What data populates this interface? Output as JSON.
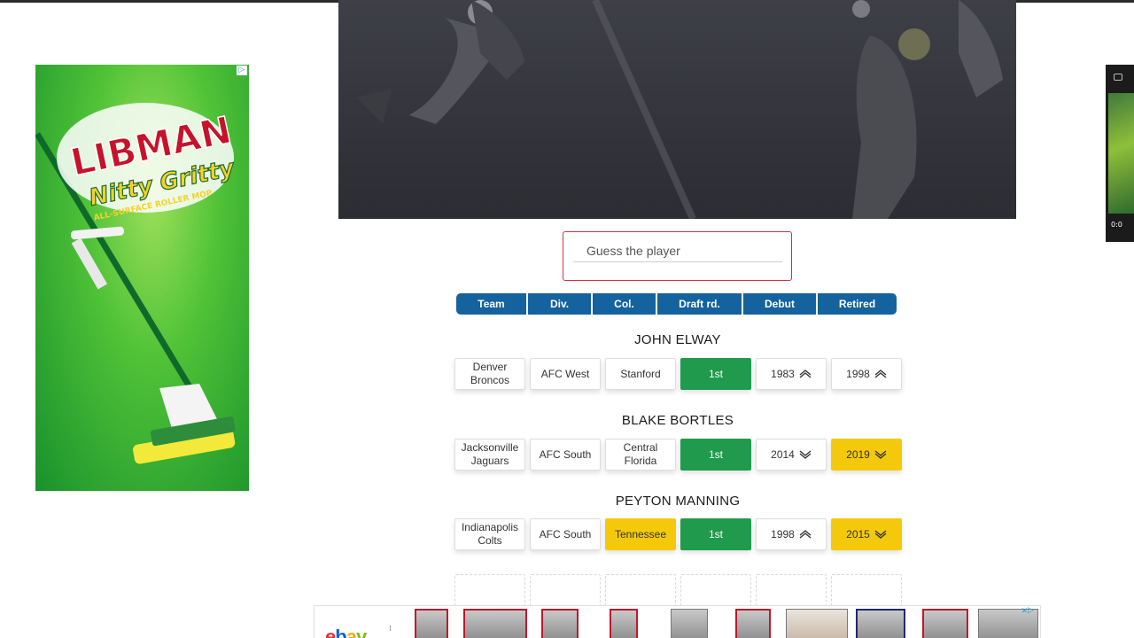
{
  "ad_left": {
    "brand": "LIBMAN",
    "product": "Nitty Gritty",
    "tagline": "ALL-SURFACE ROLLER MOP",
    "choices_icon": "adchoices-icon"
  },
  "ad_right": {
    "time": "0:0"
  },
  "guess": {
    "placeholder": "Guess the player"
  },
  "headers": [
    "Team",
    "Div.",
    "Col.",
    "Draft rd.",
    "Debut",
    "Retired"
  ],
  "guesses": [
    {
      "name": "JOHN ELWAY",
      "cells": [
        {
          "text": "Denver Broncos",
          "status": "none",
          "arrow": ""
        },
        {
          "text": "AFC West",
          "status": "none",
          "arrow": ""
        },
        {
          "text": "Stanford",
          "status": "none",
          "arrow": ""
        },
        {
          "text": "1st",
          "status": "correct",
          "arrow": ""
        },
        {
          "text": "1983",
          "status": "none",
          "arrow": "up"
        },
        {
          "text": "1998",
          "status": "none",
          "arrow": "up"
        }
      ]
    },
    {
      "name": "BLAKE BORTLES",
      "cells": [
        {
          "text": "Jacksonville Jaguars",
          "status": "none",
          "arrow": ""
        },
        {
          "text": "AFC South",
          "status": "none",
          "arrow": ""
        },
        {
          "text": "Central Florida",
          "status": "none",
          "arrow": ""
        },
        {
          "text": "1st",
          "status": "correct",
          "arrow": ""
        },
        {
          "text": "2014",
          "status": "none",
          "arrow": "down"
        },
        {
          "text": "2019",
          "status": "close",
          "arrow": "down"
        }
      ]
    },
    {
      "name": "PEYTON MANNING",
      "cells": [
        {
          "text": "Indianapolis Colts",
          "status": "none",
          "arrow": ""
        },
        {
          "text": "AFC South",
          "status": "none",
          "arrow": ""
        },
        {
          "text": "Tennessee",
          "status": "close",
          "arrow": ""
        },
        {
          "text": "1st",
          "status": "correct",
          "arrow": ""
        },
        {
          "text": "1998",
          "status": "none",
          "arrow": "up"
        },
        {
          "text": "2015",
          "status": "close",
          "arrow": "down"
        }
      ]
    }
  ],
  "empty_rows": 1,
  "ad_bottom": {
    "brand_parts": [
      "e",
      "b",
      "a",
      "y"
    ]
  },
  "colors": {
    "header_blue": "#14629e",
    "correct_green": "#209a4c",
    "close_yellow": "#f4c90c",
    "input_border_red": "#d6323c"
  }
}
